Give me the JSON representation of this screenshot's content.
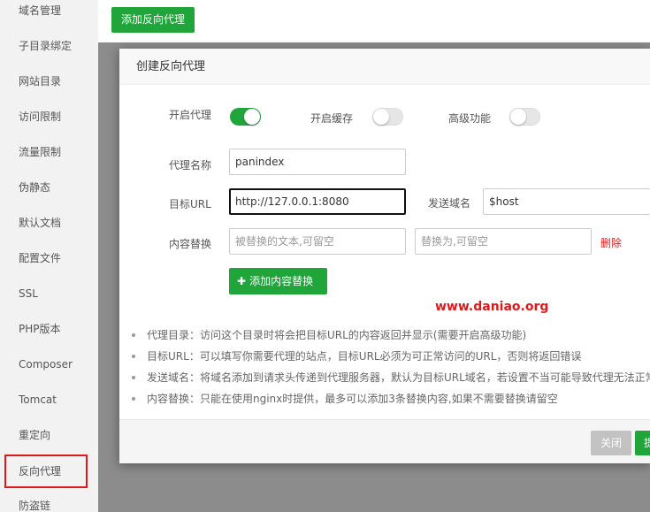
{
  "sidebar": {
    "items": [
      {
        "label": "域名管理"
      },
      {
        "label": "子目录绑定"
      },
      {
        "label": "网站目录"
      },
      {
        "label": "访问限制"
      },
      {
        "label": "流量限制"
      },
      {
        "label": "伪静态"
      },
      {
        "label": "默认文档"
      },
      {
        "label": "配置文件"
      },
      {
        "label": "SSL"
      },
      {
        "label": "PHP版本"
      },
      {
        "label": "Composer"
      },
      {
        "label": "Tomcat"
      },
      {
        "label": "重定向"
      },
      {
        "label": "反向代理",
        "active": true
      },
      {
        "label": "防盗链"
      }
    ]
  },
  "toolbar": {
    "add_proxy_label": "添加反向代理"
  },
  "modal": {
    "title": "创建反向代理",
    "enable_proxy": {
      "label": "开启代理",
      "value": true
    },
    "enable_cache": {
      "label": "开启缓存",
      "value": false
    },
    "advanced": {
      "label": "高级功能",
      "value": false
    },
    "proxy_name": {
      "label": "代理名称",
      "value": "panindex"
    },
    "target_url": {
      "label": "目标URL",
      "value": "http://127.0.0.1:8080"
    },
    "send_domain": {
      "label": "发送域名",
      "value": "$host"
    },
    "content_replace": {
      "label": "内容替换",
      "from_placeholder": "被替换的文本,可留空",
      "to_placeholder": "替换为,可留空",
      "delete_label": "删除"
    },
    "add_content_label": "添加内容替换",
    "add_content_icon": "plus-icon",
    "notes": [
      "代理目录：访问这个目录时将会把目标URL的内容返回并显示(需要开启高级功能)",
      "目标URL：可以填写你需要代理的站点，目标URL必须为可正常访问的URL，否则将返回错误",
      "发送域名：将域名添加到请求头传递到代理服务器，默认为目标URL域名，若设置不当可能导致代理无法正常",
      "内容替换：只能在使用nginx时提供，最多可以添加3条替换内容,如果不需要替换请留空"
    ],
    "close_label": "关闭",
    "submit_label": "提"
  },
  "watermark": "www.daniao.org",
  "colors": {
    "accent": "#20a53a",
    "danger": "#e0181a"
  }
}
